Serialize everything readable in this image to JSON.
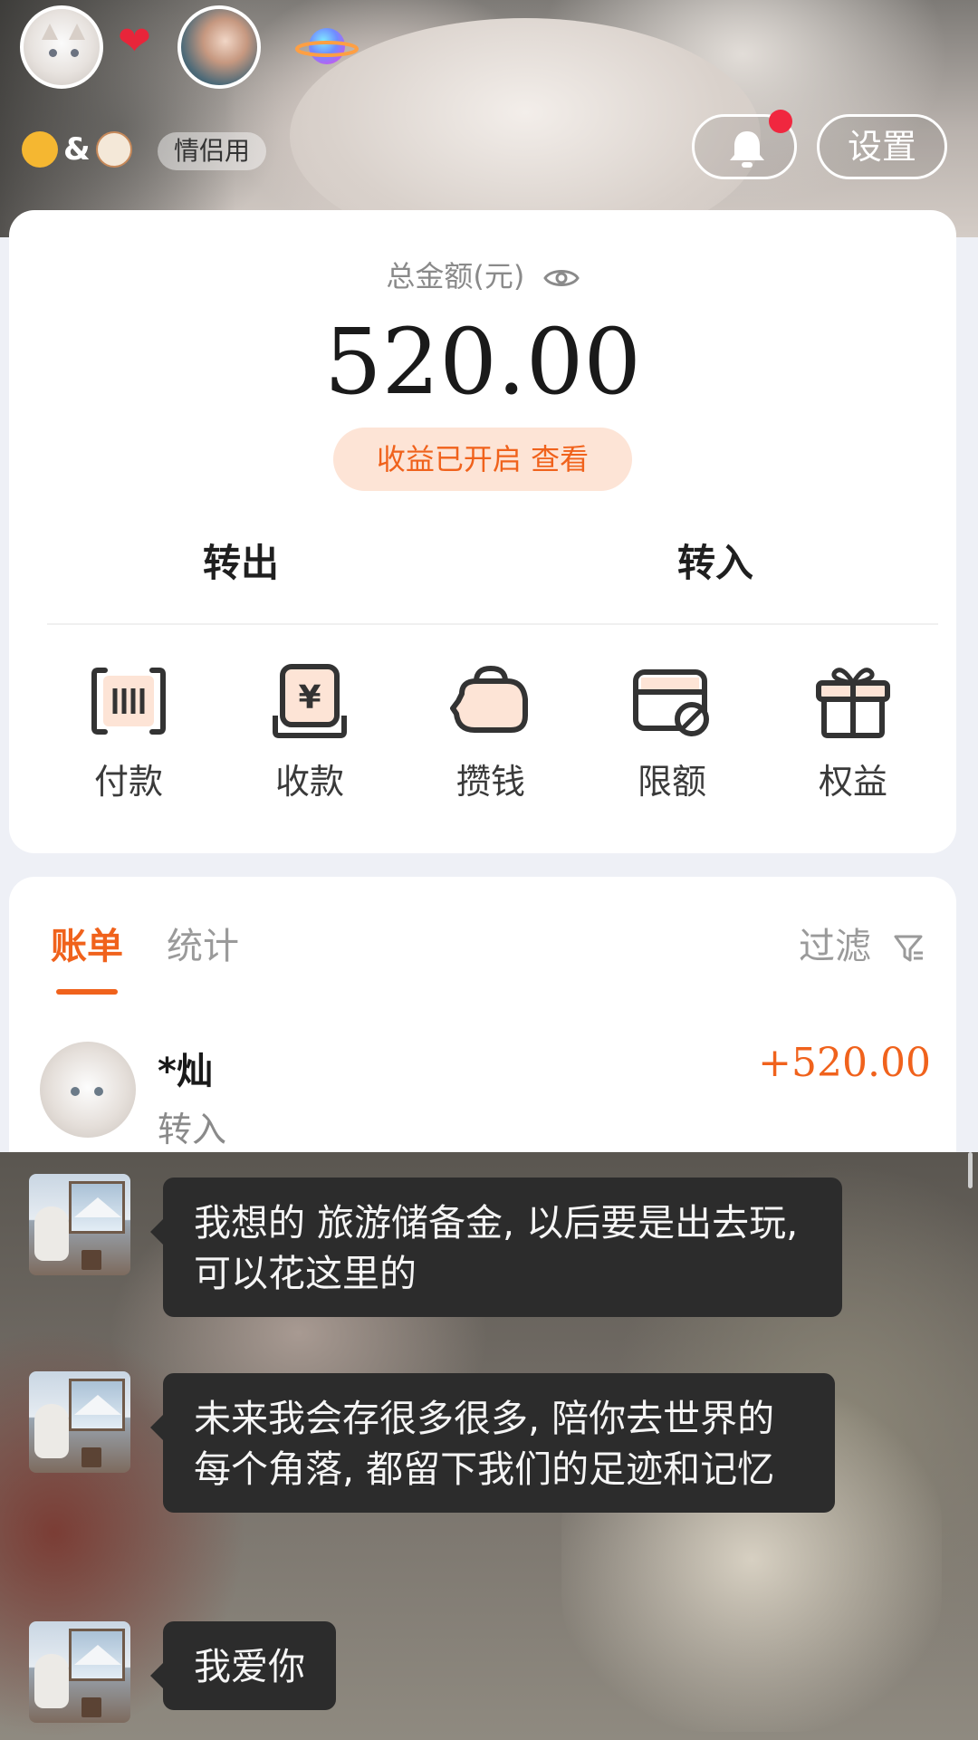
{
  "header": {
    "pet_amp": "&",
    "tag": "情侣用",
    "settings_label": "设置"
  },
  "balance": {
    "total_label": "总金额(元)",
    "amount": "520.00",
    "yield_text": "收益已开启  查看"
  },
  "transfer": {
    "out_label": "转出",
    "in_label": "转入"
  },
  "actions": [
    {
      "label": "付款",
      "icon": "payment-code-icon"
    },
    {
      "label": "收款",
      "icon": "receive-money-icon"
    },
    {
      "label": "攒钱",
      "icon": "piggy-bank-icon"
    },
    {
      "label": "限额",
      "icon": "card-limit-icon"
    },
    {
      "label": "权益",
      "icon": "gift-icon"
    }
  ],
  "bill": {
    "tab_bill": "账单",
    "tab_stats": "统计",
    "filter_label": "过滤",
    "transaction": {
      "name": "*灿",
      "type": "转入",
      "amount": "+520.00"
    }
  },
  "chat": {
    "messages": [
      {
        "text": "我想的 旅游储备金, 以后要是出去玩, 可以花这里的"
      },
      {
        "text": "未来我会存很多很多, 陪你去世界的每个角落, 都留下我们的足迹和记忆"
      },
      {
        "text": "我爱你"
      }
    ]
  },
  "colors": {
    "accent": "#f0621c",
    "accent_bg": "#fde4d6",
    "heart": "#e8253a",
    "notification_dot": "#f0273f",
    "bubble": "#2c2c2c"
  }
}
